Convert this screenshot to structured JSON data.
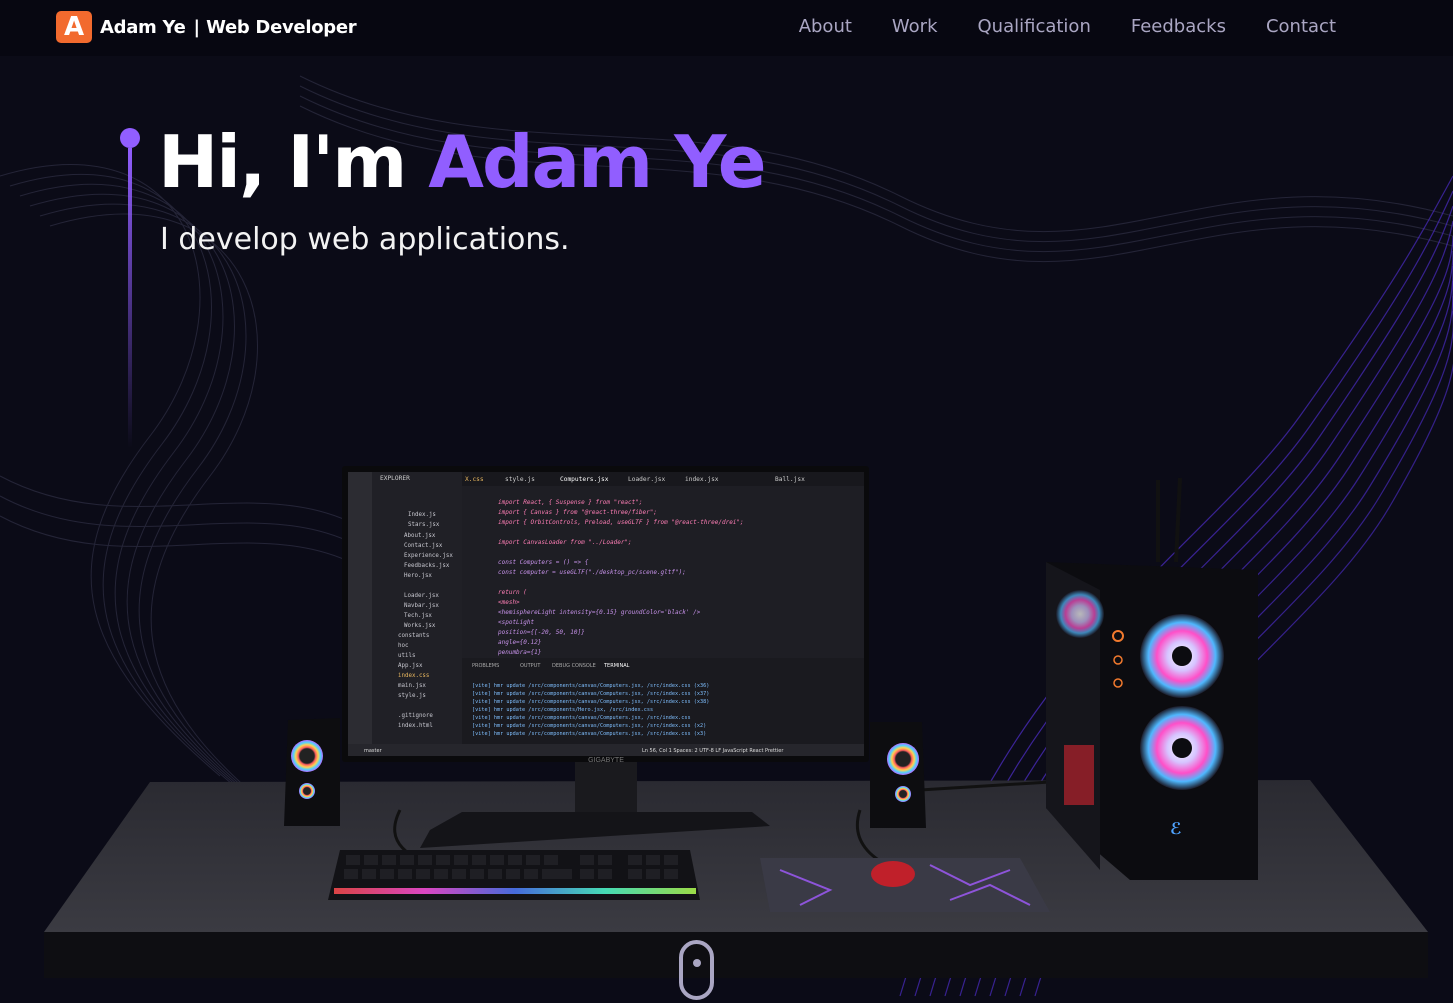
{
  "navbar": {
    "logo_letter": "A",
    "brand_name": "Adam Ye",
    "brand_separator": "|",
    "brand_role": "Web Developer",
    "links": [
      {
        "label": "About"
      },
      {
        "label": "Work"
      },
      {
        "label": "Qualification"
      },
      {
        "label": "Feedbacks"
      },
      {
        "label": "Contact"
      }
    ]
  },
  "hero": {
    "greeting": "Hi, I'm",
    "name": "Adam Ye",
    "subtitle": "I develop web applications."
  },
  "scene": {
    "monitor_brand": "GIGABYTE",
    "editor_tabs": [
      "X.css",
      "style.js",
      "Computers.jsx",
      "Loader.jsx",
      "index.jsx",
      "Ball.jsx"
    ],
    "explorer_files": [
      "Index.js",
      "Stars.jsx",
      "About.jsx",
      "Contact.jsx",
      "Experience.jsx",
      "Feedbacks.jsx",
      "Hero.jsx",
      "Loader.jsx",
      "Navbar.jsx",
      "Tech.jsx",
      "Works.jsx",
      "constants",
      "hoc",
      "utils",
      "App.jsx",
      "index.css",
      "main.jsx",
      "style.js",
      ".gitignore",
      "index.html"
    ],
    "code_lines": [
      "import React, { Suspense } from \"react\";",
      "import { Canvas } from \"@react-three/fiber\";",
      "import { OrbitControls, Preload, useGLTF } from \"@react-three/drei\";",
      "",
      "import CanvasLoader from \"../Loader\";",
      "",
      "const Computers = () => {",
      "  const computer = useGLTF(\"./desktop_pc/scene.gltf\");",
      "",
      "  return (",
      "    <mesh>",
      "      <hemisphereLight intensity={0.15} groundColor='black' />",
      "      <spotLight",
      "        position={[-20, 50, 10]}",
      "        angle={0.12}",
      "        penumbra={1}"
    ],
    "terminal_lines": [
      "[vite] hmr update /src/components/canvas/Computers.jsx, /src/index.css (x36)",
      "[vite] hmr update /src/components/canvas/Computers.jsx, /src/index.css (x37)",
      "[vite] hmr update /src/components/canvas/Computers.jsx, /src/index.css (x38)",
      "[vite] hmr update /src/components/Hero.jsx, /src/index.css",
      "[vite] hmr update /src/components/canvas/Computers.jsx, /src/index.css",
      "[vite] hmr update /src/components/canvas/Computers.jsx, /src/index.css (x2)",
      "[vite] hmr update /src/components/canvas/Computers.jsx, /src/index.css (x3)"
    ],
    "panel_tabs": [
      "PROBLEMS",
      "OUTPUT",
      "DEBUG CONSOLE",
      "TERMINAL"
    ],
    "status_left": "master",
    "status_right": "Ln 56, Col 1   Spaces: 2   UTF-8   LF   JavaScript React   Prettier"
  },
  "colors": {
    "accent": "#915eff",
    "logo_bg": "#f26a2e",
    "nav_link": "#aaa6c3",
    "background": "#0b0b17"
  }
}
